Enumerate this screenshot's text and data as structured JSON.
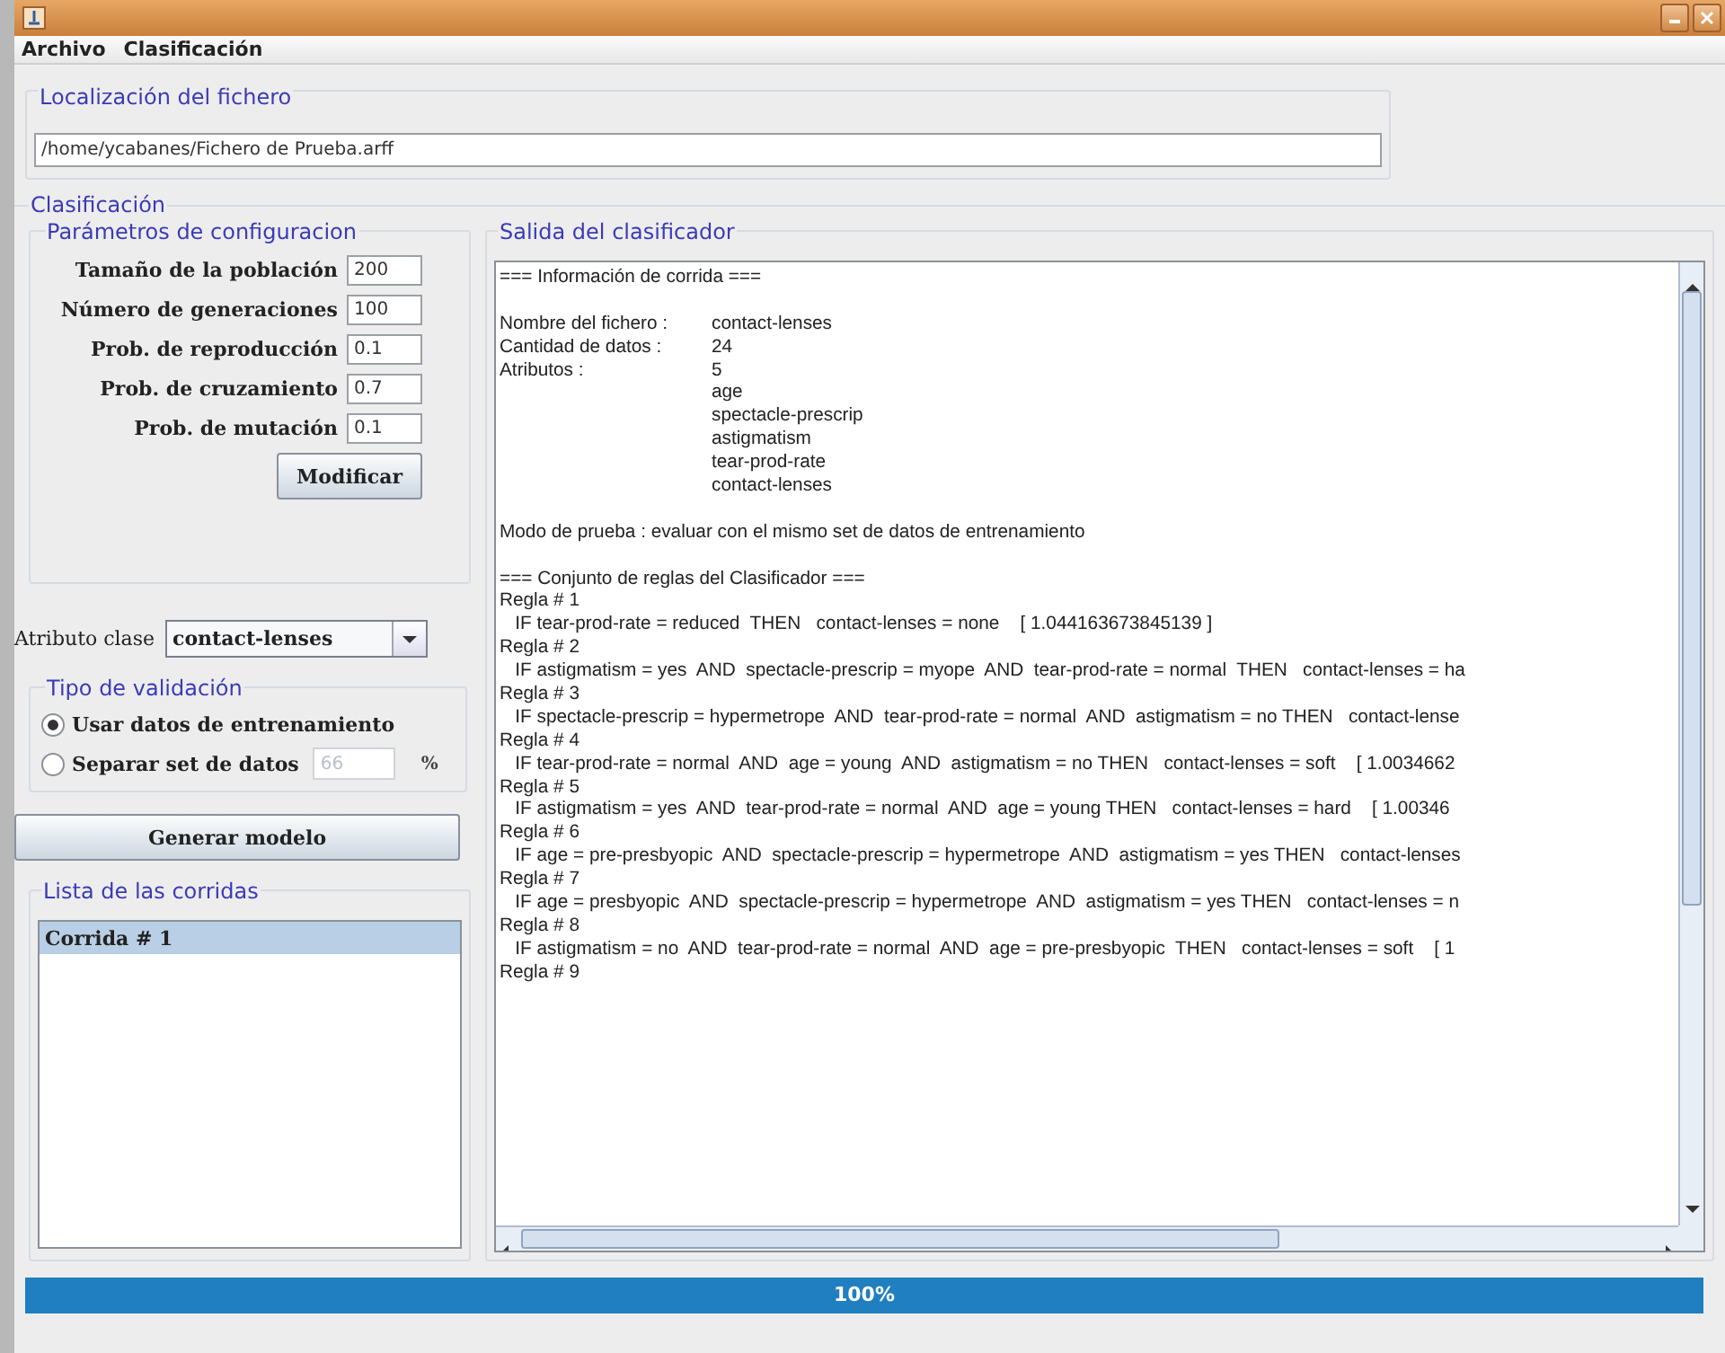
{
  "menu": [
    "Archivo",
    "Clasificación"
  ],
  "file_section": {
    "title": "Localización del fichero",
    "path": "/home/ycabanes/Fichero de Prueba.arff"
  },
  "classification": {
    "title": "Clasificación",
    "params": {
      "title": "Parámetros de configuracion",
      "fields": [
        {
          "label": "Tamaño de la población",
          "value": "200"
        },
        {
          "label": "Número de generaciones",
          "value": "100"
        },
        {
          "label": "Prob. de reproducción",
          "value": "0.1"
        },
        {
          "label": "Prob. de cruzamiento",
          "value": "0.7"
        },
        {
          "label": "Prob. de mutación",
          "value": "0.1"
        }
      ],
      "button": "Modificar"
    },
    "class_attribute": {
      "label": "Atributo clase",
      "value": "contact-lenses"
    },
    "validation": {
      "title": "Tipo de validación",
      "options": [
        {
          "label": "Usar datos de entrenamiento",
          "selected": true
        },
        {
          "label": "Separar set de datos",
          "selected": false,
          "placeholder": "66",
          "unit": "%"
        }
      ]
    },
    "generate_button": "Generar modelo",
    "runs": {
      "title": "Lista de las corridas",
      "items": [
        {
          "label": "Corrida # 1",
          "selected": true
        }
      ]
    },
    "output": {
      "title": "Salida del clasificador",
      "lines": [
        {
          "kind": "text",
          "text": "=== Información de corrida ==="
        },
        {
          "kind": "gap"
        },
        {
          "kind": "kv",
          "label": "Nombre del fichero :",
          "value": "contact-lenses"
        },
        {
          "kind": "kv",
          "label": "Cantidad de datos :",
          "value": "24"
        },
        {
          "kind": "kv",
          "label": "Atributos :",
          "value": "5"
        },
        {
          "kind": "value",
          "value": "age"
        },
        {
          "kind": "value",
          "value": "spectacle-prescrip"
        },
        {
          "kind": "value",
          "value": "astigmatism"
        },
        {
          "kind": "value",
          "value": "tear-prod-rate"
        },
        {
          "kind": "value",
          "value": "contact-lenses"
        },
        {
          "kind": "gap"
        },
        {
          "kind": "text",
          "text": "Modo de prueba : evaluar con el mismo set de datos de entrenamiento"
        },
        {
          "kind": "gap"
        },
        {
          "kind": "text",
          "text": "=== Conjunto de reglas del Clasificador ==="
        },
        {
          "kind": "text",
          "text": "Regla # 1"
        },
        {
          "kind": "rule",
          "text": "IF tear-prod-rate = reduced  THEN   contact-lenses = none    [ 1.044163673845139 ]"
        },
        {
          "kind": "text",
          "text": "Regla # 2"
        },
        {
          "kind": "rule",
          "text": "IF astigmatism = yes  AND  spectacle-prescrip = myope  AND  tear-prod-rate = normal  THEN   contact-lenses = ha"
        },
        {
          "kind": "text",
          "text": "Regla # 3"
        },
        {
          "kind": "rule",
          "text": "IF spectacle-prescrip = hypermetrope  AND  tear-prod-rate = normal  AND  astigmatism = no THEN   contact-lense"
        },
        {
          "kind": "text",
          "text": "Regla # 4"
        },
        {
          "kind": "rule",
          "text": "IF tear-prod-rate = normal  AND  age = young  AND  astigmatism = no THEN   contact-lenses = soft    [ 1.0034662"
        },
        {
          "kind": "text",
          "text": "Regla # 5"
        },
        {
          "kind": "rule",
          "text": "IF astigmatism = yes  AND  tear-prod-rate = normal  AND  age = young THEN   contact-lenses = hard    [ 1.00346"
        },
        {
          "kind": "text",
          "text": "Regla # 6"
        },
        {
          "kind": "rule",
          "text": "IF age = pre-presbyopic  AND  spectacle-prescrip = hypermetrope  AND  astigmatism = yes THEN   contact-lenses"
        },
        {
          "kind": "text",
          "text": "Regla # 7"
        },
        {
          "kind": "rule",
          "text": "IF age = presbyopic  AND  spectacle-prescrip = hypermetrope  AND  astigmatism = yes THEN   contact-lenses = n"
        },
        {
          "kind": "text",
          "text": "Regla # 8"
        },
        {
          "kind": "rule",
          "text": "IF astigmatism = no  AND  tear-prod-rate = normal  AND  age = pre-presbyopic  THEN   contact-lenses = soft    [ 1"
        },
        {
          "kind": "text",
          "text": "Regla # 9"
        }
      ]
    }
  },
  "progress": {
    "level": 1,
    "text": "100%"
  }
}
